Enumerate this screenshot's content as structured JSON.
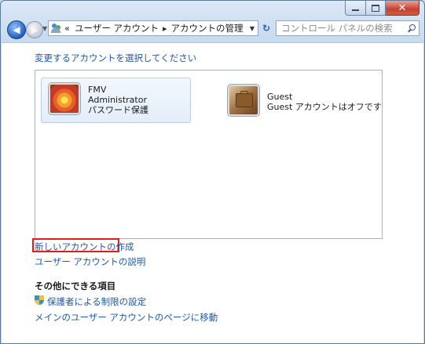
{
  "window": {
    "caption": {
      "minimize_glyph": "minimize-icon",
      "maximize_glyph": "maximize-icon",
      "close_label": "✕"
    }
  },
  "nav": {
    "back_glyph": "◀",
    "forward_glyph": "▶",
    "history_glyph": "▼",
    "breadcrumb": {
      "overflow": "«",
      "items": [
        "ユーザー アカウント",
        "アカウントの管理"
      ],
      "separator": "▸"
    },
    "address_drop_glyph": "▼",
    "refresh_glyph": "↻",
    "search_placeholder": "コントロール パネルの検索"
  },
  "main": {
    "heading": "変更するアカウントを選択してください",
    "accounts": [
      {
        "name": "FMV",
        "type": "Administrator",
        "status": "パスワード保護",
        "picture": "flower-picture"
      },
      {
        "name": "Guest",
        "status": "Guest アカウントはオフです",
        "picture": "briefcase-picture"
      }
    ],
    "links": {
      "create_account": "新しいアカウントの作成",
      "about_accounts": "ユーザー アカウントの説明"
    },
    "other": {
      "title": "その他にできる項目",
      "parental_controls": "保護者による制限の設定",
      "goto_main": "メインのユーザー アカウントのページに移動"
    },
    "highlight_color": "#e31d1d",
    "link_color": "#1c58a8"
  }
}
